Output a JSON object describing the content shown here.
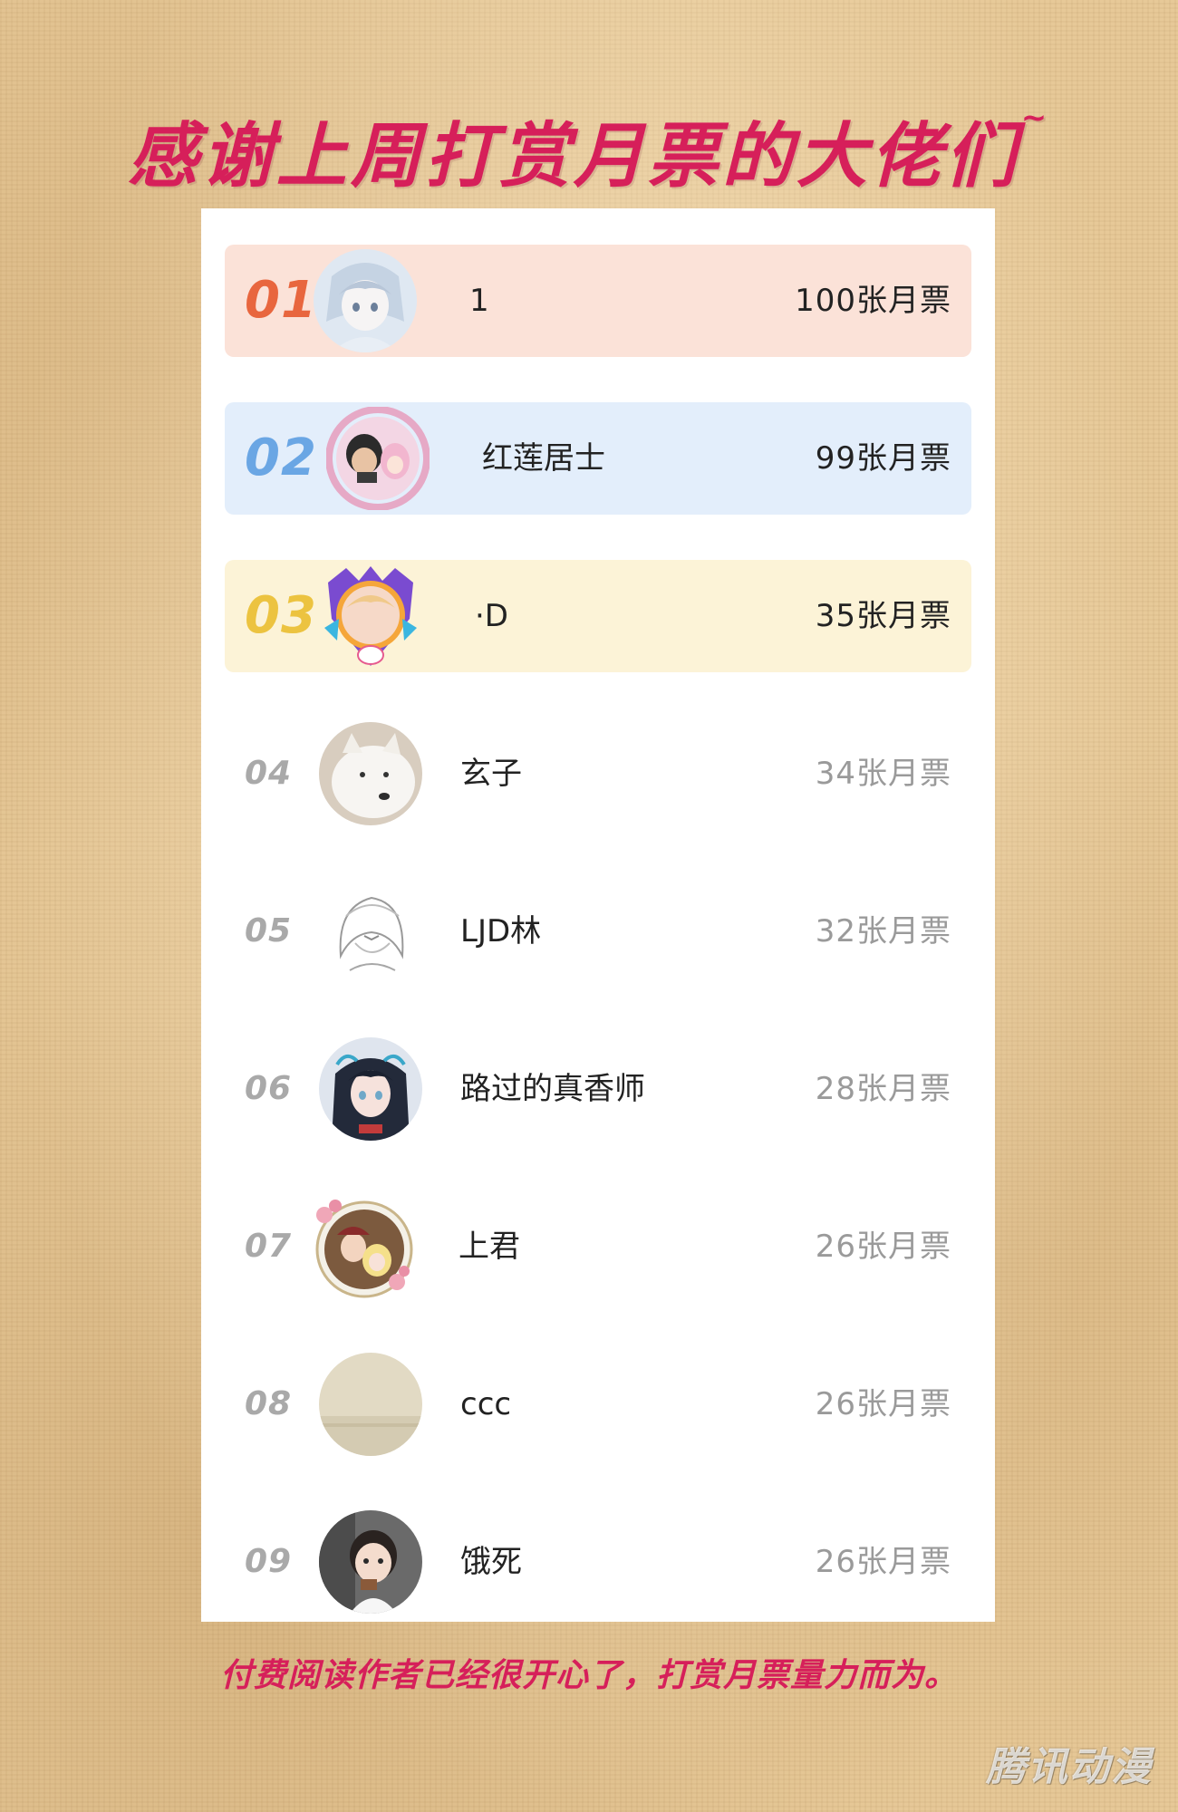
{
  "title": "感谢上周打赏月票的大佬们",
  "title_tilde": "~",
  "footer": "付费阅读作者已经很开心了，打赏月票量力而为。",
  "watermark": "腾讯动漫",
  "colors": {
    "title": "#d61f5a",
    "rank1": "#e8663e",
    "rank2": "#6aa6e4",
    "rank3": "#ecc340",
    "row1_bg": "#fbe2d8",
    "row2_bg": "#e3eefb",
    "row3_bg": "#fcf3d7"
  },
  "leaderboard": [
    {
      "rank": "01",
      "name": "1",
      "votes": "100张月票",
      "avatar_icon": "anime-girl-avatar"
    },
    {
      "rank": "02",
      "name": "红莲居士",
      "votes": "99张月票",
      "avatar_icon": "couple-dragon-frame-avatar"
    },
    {
      "rank": "03",
      "name": "·D",
      "votes": "35张月票",
      "avatar_icon": "purple-crest-frame-avatar"
    },
    {
      "rank": "04",
      "name": "玄子",
      "votes": "34张月票",
      "avatar_icon": "white-dog-avatar"
    },
    {
      "rank": "05",
      "name": "LJD林",
      "votes": "32张月票",
      "avatar_icon": "sketch-anime-avatar"
    },
    {
      "rank": "06",
      "name": "路过的真香师",
      "votes": "28张月票",
      "avatar_icon": "dark-hair-anime-avatar"
    },
    {
      "rank": "07",
      "name": "上君",
      "votes": "26张月票",
      "avatar_icon": "flower-frame-avatar"
    },
    {
      "rank": "08",
      "name": "ccc",
      "votes": "26张月票",
      "avatar_icon": "beige-plain-avatar"
    },
    {
      "rank": "09",
      "name": "饿死",
      "votes": "26张月票",
      "avatar_icon": "child-photo-avatar"
    }
  ]
}
